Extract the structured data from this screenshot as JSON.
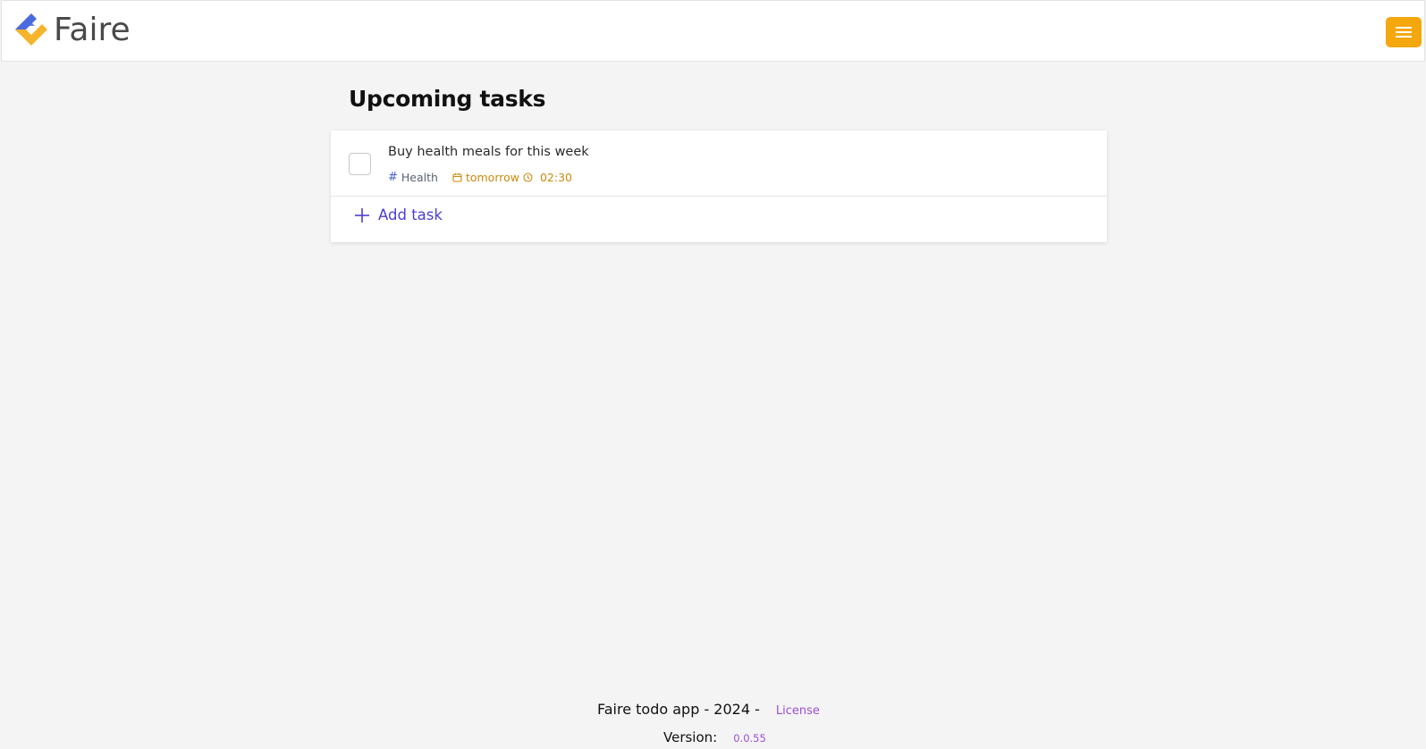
{
  "header": {
    "logo_text": "Faire",
    "menu_icon": "hamburger-icon",
    "accent_color": "#f5a70e"
  },
  "main": {
    "title": "Upcoming tasks",
    "tasks": [
      {
        "title": "Buy health meals for this week",
        "tag": "Health",
        "due_date": "tomorrow",
        "due_time": "02:30",
        "completed": false
      }
    ],
    "add_task_label": "Add task"
  },
  "footer": {
    "text": "Faire todo app - 2024 -",
    "license_label": "License",
    "version_label": "Version:",
    "version_value": "0.0.55"
  }
}
